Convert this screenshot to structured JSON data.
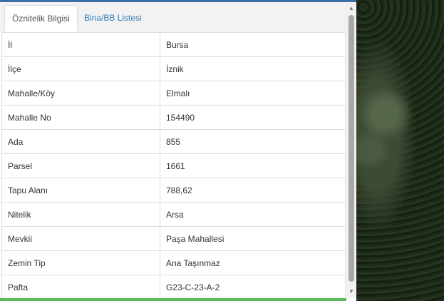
{
  "tabs": [
    {
      "label": "Öznitelik Bilgisi",
      "active": true
    },
    {
      "label": "Bina/BB Listesi",
      "active": false
    }
  ],
  "rows": [
    {
      "key": "İl",
      "value": "Bursa"
    },
    {
      "key": "İlçe",
      "value": "İznik"
    },
    {
      "key": "Mahalle/Köy",
      "value": "Elmalı"
    },
    {
      "key": "Mahalle No",
      "value": "154490"
    },
    {
      "key": "Ada",
      "value": "855"
    },
    {
      "key": "Parsel",
      "value": "1661"
    },
    {
      "key": "Tapu Alanı",
      "value": "788,62"
    },
    {
      "key": "Nitelik",
      "value": "Arsa"
    },
    {
      "key": "Mevkii",
      "value": "Paşa Mahallesi"
    },
    {
      "key": "Zemin Tip",
      "value": "Ana Taşınmaz"
    },
    {
      "key": "Pafta",
      "value": "G23-C-23-A-2"
    }
  ],
  "scrollbar": {
    "up_icon": "▲",
    "down_icon": "▼"
  },
  "colors": {
    "accent_top": "#3a6ea5",
    "accent_bottom": "#5cb85c",
    "link": "#337ab7"
  }
}
